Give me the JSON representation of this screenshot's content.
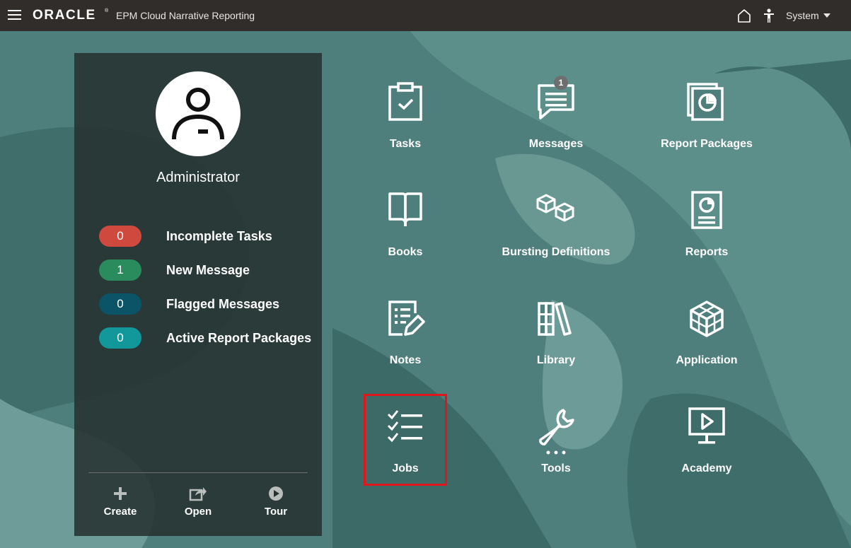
{
  "header": {
    "logo_text": "ORACLE",
    "logo_mark": "®",
    "app_title": "EPM Cloud Narrative Reporting",
    "user_menu_label": "System"
  },
  "profile": {
    "name": "Administrator",
    "stats": [
      {
        "count": "0",
        "label": "Incomplete Tasks",
        "color": "#d0493e"
      },
      {
        "count": "1",
        "label": "New Message",
        "color": "#2a8b5c"
      },
      {
        "count": "0",
        "label": "Flagged Messages",
        "color": "#0b5468"
      },
      {
        "count": "0",
        "label": "Active Report Packages",
        "color": "#12979a"
      }
    ],
    "actions": [
      {
        "label": "Create",
        "icon": "plus-icon"
      },
      {
        "label": "Open",
        "icon": "open-share-icon"
      },
      {
        "label": "Tour",
        "icon": "play-circle-icon"
      }
    ]
  },
  "tiles": [
    {
      "label": "Tasks",
      "icon": "clipboard-check-icon"
    },
    {
      "label": "Messages",
      "icon": "message-icon",
      "badge": "1"
    },
    {
      "label": "Report Packages",
      "icon": "report-packages-icon"
    },
    {
      "label": "Books",
      "icon": "book-icon"
    },
    {
      "label": "Bursting Definitions",
      "icon": "cubes-icon"
    },
    {
      "label": "Reports",
      "icon": "report-icon"
    },
    {
      "label": "Notes",
      "icon": "notes-icon"
    },
    {
      "label": "Library",
      "icon": "library-icon"
    },
    {
      "label": "Application",
      "icon": "application-cube-icon"
    },
    {
      "label": "Jobs",
      "icon": "jobs-checklist-icon"
    },
    {
      "label": "Tools",
      "icon": "wrench-icon"
    },
    {
      "label": "Academy",
      "icon": "monitor-play-icon"
    }
  ],
  "colors": {
    "topbar": "#312d2a",
    "background": "#4f7f7c",
    "panel": "#263230",
    "highlight": "#e0161d"
  }
}
